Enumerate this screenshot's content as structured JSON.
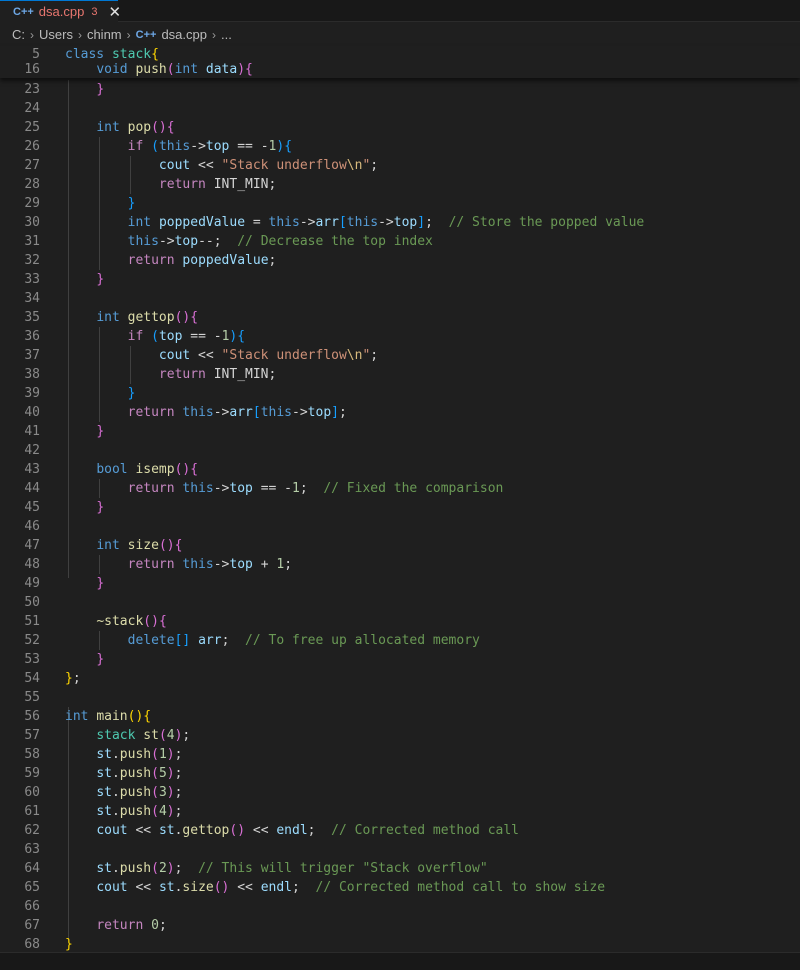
{
  "tab": {
    "icon": "C++",
    "filename": "dsa.cpp",
    "problem_count": "3",
    "close_label": "✕"
  },
  "breadcrumb": {
    "parts": [
      "C:",
      "Users",
      "chinm",
      "dsa.cpp",
      "..."
    ]
  },
  "sticky_lines": [
    {
      "n": "5",
      "tokens": [
        [
          "kw",
          "class"
        ],
        [
          "op",
          " "
        ],
        [
          "type",
          "stack"
        ],
        [
          "p1",
          "{"
        ]
      ]
    },
    {
      "n": "16",
      "tokens": [
        [
          "op",
          "    "
        ],
        [
          "kw",
          "void"
        ],
        [
          "op",
          " "
        ],
        [
          "fn",
          "push"
        ],
        [
          "p2",
          "("
        ],
        [
          "kw",
          "int"
        ],
        [
          "op",
          " "
        ],
        [
          "var",
          "data"
        ],
        [
          "p2",
          ")"
        ],
        [
          "p2",
          "{"
        ]
      ]
    }
  ],
  "code_lines": [
    {
      "n": "23",
      "tokens": [
        [
          "op",
          "    "
        ],
        [
          "p2",
          "}"
        ]
      ]
    },
    {
      "n": "24",
      "tokens": []
    },
    {
      "n": "25",
      "tokens": [
        [
          "op",
          "    "
        ],
        [
          "kw",
          "int"
        ],
        [
          "op",
          " "
        ],
        [
          "fn",
          "pop"
        ],
        [
          "p2",
          "()"
        ],
        [
          "p2",
          "{"
        ]
      ]
    },
    {
      "n": "26",
      "tokens": [
        [
          "op",
          "        "
        ],
        [
          "ctl",
          "if"
        ],
        [
          "op",
          " "
        ],
        [
          "p3",
          "("
        ],
        [
          "kw",
          "this"
        ],
        [
          "op",
          "->"
        ],
        [
          "var",
          "top"
        ],
        [
          "op",
          " == -"
        ],
        [
          "num",
          "1"
        ],
        [
          "p3",
          ")"
        ],
        [
          "p3",
          "{"
        ]
      ]
    },
    {
      "n": "27",
      "tokens": [
        [
          "op",
          "            "
        ],
        [
          "var",
          "cout"
        ],
        [
          "op",
          " << "
        ],
        [
          "str",
          "\"Stack underflow"
        ],
        [
          "esc",
          "\\n"
        ],
        [
          "str",
          "\""
        ],
        [
          "op",
          ";"
        ]
      ]
    },
    {
      "n": "28",
      "tokens": [
        [
          "op",
          "            "
        ],
        [
          "ctl",
          "return"
        ],
        [
          "op",
          " "
        ],
        [
          "mac",
          "INT_MIN"
        ],
        [
          "op",
          ";"
        ]
      ]
    },
    {
      "n": "29",
      "tokens": [
        [
          "op",
          "        "
        ],
        [
          "p3",
          "}"
        ]
      ]
    },
    {
      "n": "30",
      "tokens": [
        [
          "op",
          "        "
        ],
        [
          "kw",
          "int"
        ],
        [
          "op",
          " "
        ],
        [
          "var",
          "poppedValue"
        ],
        [
          "op",
          " = "
        ],
        [
          "kw",
          "this"
        ],
        [
          "op",
          "->"
        ],
        [
          "var",
          "arr"
        ],
        [
          "p3",
          "["
        ],
        [
          "kw",
          "this"
        ],
        [
          "op",
          "->"
        ],
        [
          "var",
          "top"
        ],
        [
          "p3",
          "]"
        ],
        [
          "op",
          ";  "
        ],
        [
          "com",
          "// Store the popped value"
        ]
      ]
    },
    {
      "n": "31",
      "tokens": [
        [
          "op",
          "        "
        ],
        [
          "kw",
          "this"
        ],
        [
          "op",
          "->"
        ],
        [
          "var",
          "top"
        ],
        [
          "op",
          "--;  "
        ],
        [
          "com",
          "// Decrease the top index"
        ]
      ]
    },
    {
      "n": "32",
      "tokens": [
        [
          "op",
          "        "
        ],
        [
          "ctl",
          "return"
        ],
        [
          "op",
          " "
        ],
        [
          "var",
          "poppedValue"
        ],
        [
          "op",
          ";"
        ]
      ]
    },
    {
      "n": "33",
      "tokens": [
        [
          "op",
          "    "
        ],
        [
          "p2",
          "}"
        ]
      ]
    },
    {
      "n": "34",
      "tokens": []
    },
    {
      "n": "35",
      "tokens": [
        [
          "op",
          "    "
        ],
        [
          "kw",
          "int"
        ],
        [
          "op",
          " "
        ],
        [
          "fn",
          "gettop"
        ],
        [
          "p2",
          "()"
        ],
        [
          "p2",
          "{"
        ]
      ]
    },
    {
      "n": "36",
      "tokens": [
        [
          "op",
          "        "
        ],
        [
          "ctl",
          "if"
        ],
        [
          "op",
          " "
        ],
        [
          "p3",
          "("
        ],
        [
          "var",
          "top"
        ],
        [
          "op",
          " == -"
        ],
        [
          "num",
          "1"
        ],
        [
          "p3",
          ")"
        ],
        [
          "p3",
          "{"
        ]
      ]
    },
    {
      "n": "37",
      "tokens": [
        [
          "op",
          "            "
        ],
        [
          "var",
          "cout"
        ],
        [
          "op",
          " << "
        ],
        [
          "str",
          "\"Stack underflow"
        ],
        [
          "esc",
          "\\n"
        ],
        [
          "str",
          "\""
        ],
        [
          "op",
          ";"
        ]
      ]
    },
    {
      "n": "38",
      "tokens": [
        [
          "op",
          "            "
        ],
        [
          "ctl",
          "return"
        ],
        [
          "op",
          " "
        ],
        [
          "mac",
          "INT_MIN"
        ],
        [
          "op",
          ";"
        ]
      ]
    },
    {
      "n": "39",
      "tokens": [
        [
          "op",
          "        "
        ],
        [
          "p3",
          "}"
        ]
      ]
    },
    {
      "n": "40",
      "tokens": [
        [
          "op",
          "        "
        ],
        [
          "ctl",
          "return"
        ],
        [
          "op",
          " "
        ],
        [
          "kw",
          "this"
        ],
        [
          "op",
          "->"
        ],
        [
          "var",
          "arr"
        ],
        [
          "p3",
          "["
        ],
        [
          "kw",
          "this"
        ],
        [
          "op",
          "->"
        ],
        [
          "var",
          "top"
        ],
        [
          "p3",
          "]"
        ],
        [
          "op",
          ";"
        ]
      ]
    },
    {
      "n": "41",
      "tokens": [
        [
          "op",
          "    "
        ],
        [
          "p2",
          "}"
        ]
      ]
    },
    {
      "n": "42",
      "tokens": []
    },
    {
      "n": "43",
      "tokens": [
        [
          "op",
          "    "
        ],
        [
          "kw",
          "bool"
        ],
        [
          "op",
          " "
        ],
        [
          "fn",
          "isemp"
        ],
        [
          "p2",
          "()"
        ],
        [
          "p2",
          "{"
        ]
      ]
    },
    {
      "n": "44",
      "tokens": [
        [
          "op",
          "        "
        ],
        [
          "ctl",
          "return"
        ],
        [
          "op",
          " "
        ],
        [
          "kw",
          "this"
        ],
        [
          "op",
          "->"
        ],
        [
          "var",
          "top"
        ],
        [
          "op",
          " == -"
        ],
        [
          "num",
          "1"
        ],
        [
          "op",
          ";  "
        ],
        [
          "com",
          "// Fixed the comparison"
        ]
      ]
    },
    {
      "n": "45",
      "tokens": [
        [
          "op",
          "    "
        ],
        [
          "p2",
          "}"
        ]
      ]
    },
    {
      "n": "46",
      "tokens": []
    },
    {
      "n": "47",
      "tokens": [
        [
          "op",
          "    "
        ],
        [
          "kw",
          "int"
        ],
        [
          "op",
          " "
        ],
        [
          "fn",
          "size"
        ],
        [
          "p2",
          "()"
        ],
        [
          "p2",
          "{"
        ]
      ]
    },
    {
      "n": "48",
      "tokens": [
        [
          "op",
          "        "
        ],
        [
          "ctl",
          "return"
        ],
        [
          "op",
          " "
        ],
        [
          "kw",
          "this"
        ],
        [
          "op",
          "->"
        ],
        [
          "var",
          "top"
        ],
        [
          "op",
          " + "
        ],
        [
          "num",
          "1"
        ],
        [
          "op",
          ";"
        ]
      ]
    },
    {
      "n": "49",
      "tokens": [
        [
          "op",
          "    "
        ],
        [
          "p2",
          "}"
        ]
      ]
    },
    {
      "n": "50",
      "tokens": []
    },
    {
      "n": "51",
      "tokens": [
        [
          "op",
          "    "
        ],
        [
          "fn",
          "~stack"
        ],
        [
          "p2",
          "()"
        ],
        [
          "p2",
          "{"
        ]
      ]
    },
    {
      "n": "52",
      "tokens": [
        [
          "op",
          "        "
        ],
        [
          "kw",
          "delete"
        ],
        [
          "p3",
          "[]"
        ],
        [
          "op",
          " "
        ],
        [
          "var",
          "arr"
        ],
        [
          "op",
          ";  "
        ],
        [
          "com",
          "// To free up allocated memory"
        ]
      ]
    },
    {
      "n": "53",
      "tokens": [
        [
          "op",
          "    "
        ],
        [
          "p2",
          "}"
        ]
      ]
    },
    {
      "n": "54",
      "tokens": [
        [
          "p1",
          "}"
        ],
        [
          "op",
          ";"
        ]
      ]
    },
    {
      "n": "55",
      "tokens": []
    },
    {
      "n": "56",
      "tokens": [
        [
          "kw",
          "int"
        ],
        [
          "op",
          " "
        ],
        [
          "fn",
          "main"
        ],
        [
          "p1",
          "()"
        ],
        [
          "p1",
          "{"
        ]
      ]
    },
    {
      "n": "57",
      "tokens": [
        [
          "op",
          "    "
        ],
        [
          "type",
          "stack"
        ],
        [
          "op",
          " "
        ],
        [
          "fn",
          "st"
        ],
        [
          "p2",
          "("
        ],
        [
          "num",
          "4"
        ],
        [
          "p2",
          ")"
        ],
        [
          "op",
          ";"
        ]
      ]
    },
    {
      "n": "58",
      "tokens": [
        [
          "op",
          "    "
        ],
        [
          "var",
          "st"
        ],
        [
          "op",
          "."
        ],
        [
          "fn",
          "push"
        ],
        [
          "p2",
          "("
        ],
        [
          "num",
          "1"
        ],
        [
          "p2",
          ")"
        ],
        [
          "op",
          ";"
        ]
      ]
    },
    {
      "n": "59",
      "tokens": [
        [
          "op",
          "    "
        ],
        [
          "var",
          "st"
        ],
        [
          "op",
          "."
        ],
        [
          "fn",
          "push"
        ],
        [
          "p2",
          "("
        ],
        [
          "num",
          "5"
        ],
        [
          "p2",
          ")"
        ],
        [
          "op",
          ";"
        ]
      ]
    },
    {
      "n": "60",
      "tokens": [
        [
          "op",
          "    "
        ],
        [
          "var",
          "st"
        ],
        [
          "op",
          "."
        ],
        [
          "fn",
          "push"
        ],
        [
          "p2",
          "("
        ],
        [
          "num",
          "3"
        ],
        [
          "p2",
          ")"
        ],
        [
          "op",
          ";"
        ]
      ]
    },
    {
      "n": "61",
      "tokens": [
        [
          "op",
          "    "
        ],
        [
          "var",
          "st"
        ],
        [
          "op",
          "."
        ],
        [
          "fn",
          "push"
        ],
        [
          "p2",
          "("
        ],
        [
          "num",
          "4"
        ],
        [
          "p2",
          ")"
        ],
        [
          "op",
          ";"
        ]
      ]
    },
    {
      "n": "62",
      "tokens": [
        [
          "op",
          "    "
        ],
        [
          "var",
          "cout"
        ],
        [
          "op",
          " << "
        ],
        [
          "var",
          "st"
        ],
        [
          "op",
          "."
        ],
        [
          "fn",
          "gettop"
        ],
        [
          "p2",
          "()"
        ],
        [
          "op",
          " << "
        ],
        [
          "var",
          "endl"
        ],
        [
          "op",
          ";  "
        ],
        [
          "com",
          "// Corrected method call"
        ]
      ]
    },
    {
      "n": "63",
      "tokens": []
    },
    {
      "n": "64",
      "tokens": [
        [
          "op",
          "    "
        ],
        [
          "var",
          "st"
        ],
        [
          "op",
          "."
        ],
        [
          "fn",
          "push"
        ],
        [
          "p2",
          "("
        ],
        [
          "num",
          "2"
        ],
        [
          "p2",
          ")"
        ],
        [
          "op",
          ";  "
        ],
        [
          "com",
          "// This will trigger \"Stack overflow\""
        ]
      ]
    },
    {
      "n": "65",
      "tokens": [
        [
          "op",
          "    "
        ],
        [
          "var",
          "cout"
        ],
        [
          "op",
          " << "
        ],
        [
          "var",
          "st"
        ],
        [
          "op",
          "."
        ],
        [
          "fn",
          "size"
        ],
        [
          "p2",
          "()"
        ],
        [
          "op",
          " << "
        ],
        [
          "var",
          "endl"
        ],
        [
          "op",
          ";  "
        ],
        [
          "com",
          "// Corrected method call to show size"
        ]
      ]
    },
    {
      "n": "66",
      "tokens": []
    },
    {
      "n": "67",
      "tokens": [
        [
          "op",
          "    "
        ],
        [
          "ctl",
          "return"
        ],
        [
          "op",
          " "
        ],
        [
          "num",
          "0"
        ],
        [
          "op",
          ";"
        ]
      ]
    },
    {
      "n": "68",
      "tokens": [
        [
          "p1",
          "}"
        ]
      ]
    }
  ],
  "colors": {
    "editor_background": "#1f1f1f",
    "keyword": "#569cd6",
    "control": "#c586c0",
    "function": "#dcdcaa",
    "variable": "#9cdcfe",
    "string": "#ce9178",
    "number": "#b5cea8",
    "comment": "#6a9955",
    "type": "#4ec9b0",
    "bracket_level_1": "#ffd700",
    "bracket_level_2": "#da70d6",
    "bracket_level_3": "#179fff"
  }
}
